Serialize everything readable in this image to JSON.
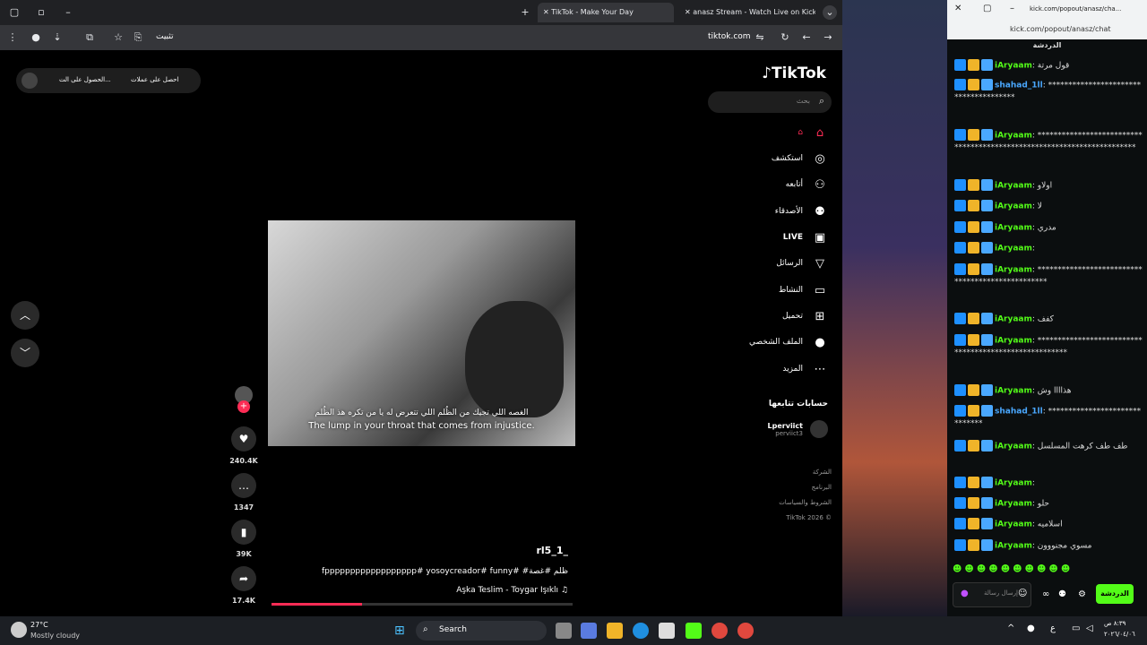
{
  "browser": {
    "tabs": [
      {
        "label": "TikTok - Make Your Day",
        "active": true
      },
      {
        "label": "anasz Stream - Watch Live on Kick",
        "active": false
      }
    ],
    "address": "tiktok.com",
    "install_label": "تثبيت"
  },
  "tiktok": {
    "logo_text": "TikTok",
    "search_placeholder": "بحث",
    "top_banner": {
      "coins_label": "احصل على عملات",
      "app_label": "الحصول على الت..."
    },
    "nav": [
      {
        "label": "",
        "icon": "home-icon"
      },
      {
        "label": "استكشف",
        "icon": "compass-icon"
      },
      {
        "label": "أتابعه",
        "icon": "user-follow-icon"
      },
      {
        "label": "الأصدقاء",
        "icon": "friends-icon"
      },
      {
        "label": "LIVE",
        "icon": "live-tv-icon"
      },
      {
        "label": "الرسائل",
        "icon": "send-icon"
      },
      {
        "label": "النشاط",
        "icon": "activity-icon"
      },
      {
        "label": "تحميل",
        "icon": "upload-icon"
      },
      {
        "label": "الملف الشخصي",
        "icon": "profile-icon"
      },
      {
        "label": "المزيد",
        "icon": "more-icon"
      }
    ],
    "following_header": "حسابات تتابعها",
    "following_account": {
      "name": "Lperviict",
      "handle": "perviict3"
    },
    "footer_links": [
      "الشركة",
      "البرنامج",
      "الشروط والسياسات"
    ],
    "copyright": "TikTok 2026 ©",
    "video": {
      "caption_ar": "الغصه اللي تجيك من الظُلم اللي تتعرض له يا من تكره هذ الظُلم",
      "caption_en": "The lump in your throat that comes from injustice.",
      "author": "rl5_1_",
      "description": "fpppppppppppppppppp# yosoycreador# funny# #ظلم #غصة",
      "music": "Aşka Teslim - Toygar Işıklı",
      "progress": 0.3
    },
    "actions": {
      "likes": "240.4K",
      "comments": "1347",
      "saves": "39K",
      "shares": "17.4K"
    }
  },
  "chat": {
    "url": "kick.com/popout/anasz/cha...",
    "url_full": "kick.com/popout/anasz/chat",
    "header": "الدردشة",
    "messages": [
      {
        "user": "iAryaam",
        "text": "قول مرتة",
        "color": "#53fc18"
      },
      {
        "user": "shahad_1ll",
        "text": "**************************************",
        "color": "#4aa8ff"
      },
      {
        "user": "iAryaam",
        "text": "***********************************************************************",
        "color": "#53fc18"
      },
      {
        "user": "iAryaam",
        "text": "اولاو",
        "color": "#53fc18"
      },
      {
        "user": "iAryaam",
        "text": "لا",
        "color": "#53fc18"
      },
      {
        "user": "iAryaam",
        "text": "مدري",
        "color": "#53fc18"
      },
      {
        "user": "iAryaam",
        "text": "",
        "color": "#53fc18"
      },
      {
        "user": "iAryaam",
        "text": "*************************************************",
        "color": "#53fc18"
      },
      {
        "user": "iAryaam",
        "text": "كفف",
        "color": "#53fc18"
      },
      {
        "user": "iAryaam",
        "text": "******************************************************",
        "color": "#53fc18"
      },
      {
        "user": "iAryaam",
        "text": "هذاااا وش",
        "color": "#53fc18"
      },
      {
        "user": "shahad_1ll",
        "text": "******************************",
        "color": "#4aa8ff"
      },
      {
        "user": "iAryaam",
        "text": "طف طف كرهت المسلسل",
        "color": "#53fc18"
      },
      {
        "user": "iAryaam",
        "text": "",
        "color": "#53fc18"
      },
      {
        "user": "iAryaam",
        "text": "حلو",
        "color": "#53fc18"
      },
      {
        "user": "iAryaam",
        "text": "اسلاميه",
        "color": "#53fc18"
      },
      {
        "user": "iAryaam",
        "text": "مسوي مجنووون",
        "color": "#53fc18"
      }
    ],
    "input_placeholder": "إرسال رسالة",
    "send_label": "الدردشة",
    "accent": "#53fc18"
  },
  "taskbar": {
    "weather_temp": "27°C",
    "weather_desc": "Mostly cloudy",
    "search_label": "Search",
    "time": "٨:٣٩ ص",
    "date": "٢٠٢٦/٠٤/٠٦"
  }
}
